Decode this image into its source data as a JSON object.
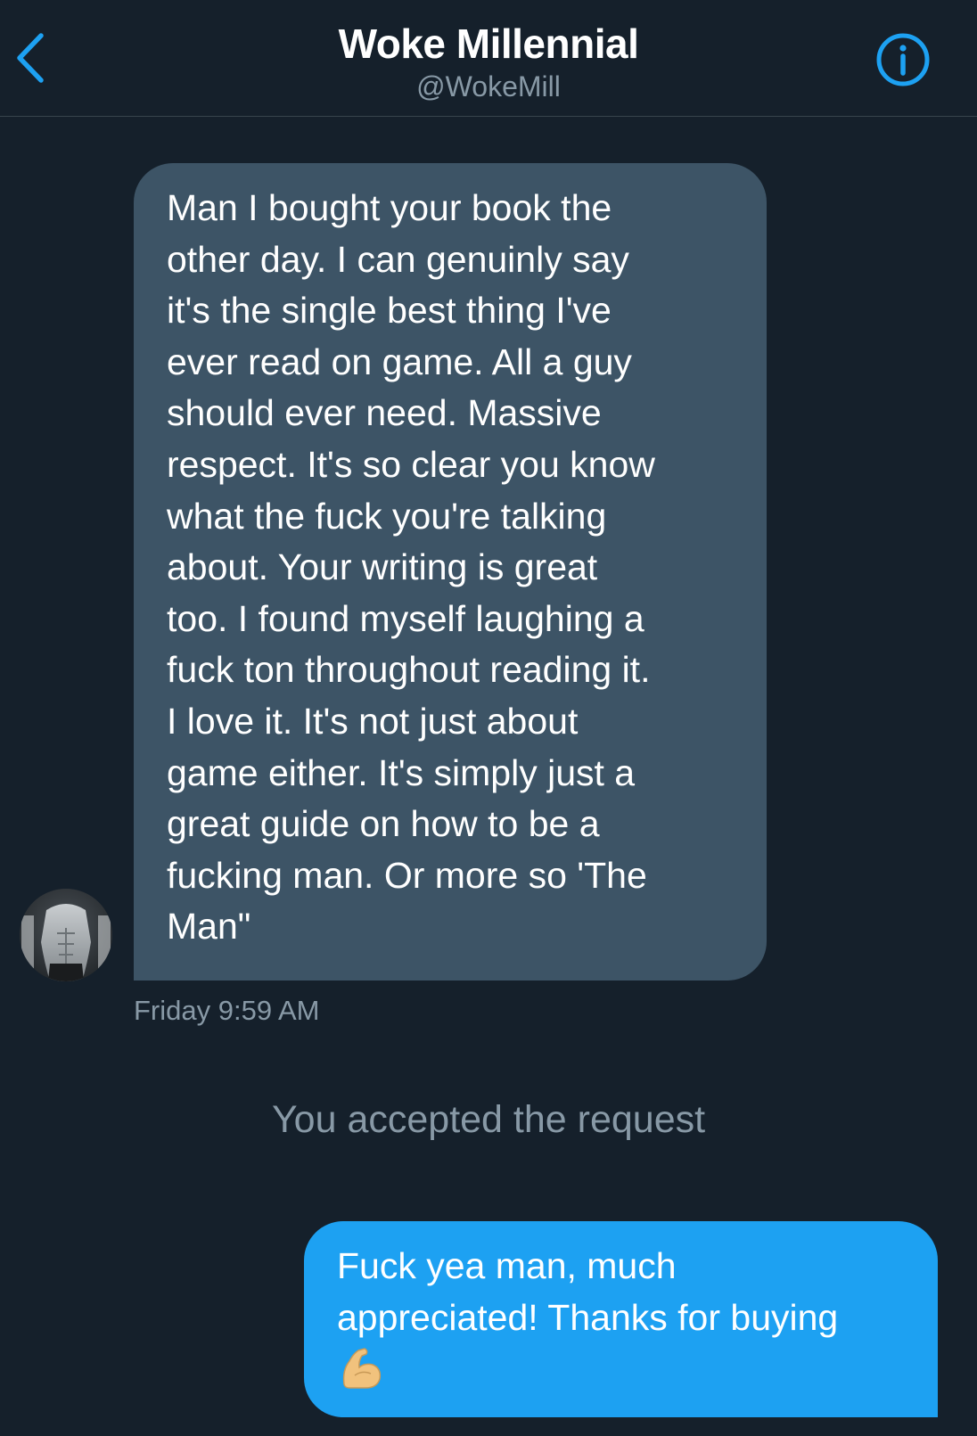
{
  "header": {
    "title": "Woke Millennial",
    "handle": "@WokeMill",
    "back_icon": "chevron-left-icon",
    "info_icon": "info-icon"
  },
  "conversation": {
    "incoming": {
      "text": "Man I bought your book the\nother day. I can genuinly say\nit's the single best thing I've\never read on game. All a guy\nshould ever need. Massive\nrespect. It's so clear you know\nwhat the fuck you're talking\nabout. Your writing is great\ntoo. I found myself laughing a\nfuck ton throughout reading it.\nI love it. It's not just about\ngame either. It's simply just a\ngreat guide on how to be a\nfucking man. Or more so 'The\nMan\"",
      "timestamp": "Friday 9:59 AM"
    },
    "system_message": "You accepted the request",
    "outgoing": {
      "line1": "Fuck yea man, much",
      "line2": "appreciated! Thanks for buying",
      "emoji": "flexed-biceps-icon"
    }
  },
  "colors": {
    "background": "#15202b",
    "incoming_bubble": "#3d5466",
    "outgoing_bubble": "#1da1f2",
    "accent": "#1da1f2",
    "secondary_text": "#8899a6"
  }
}
